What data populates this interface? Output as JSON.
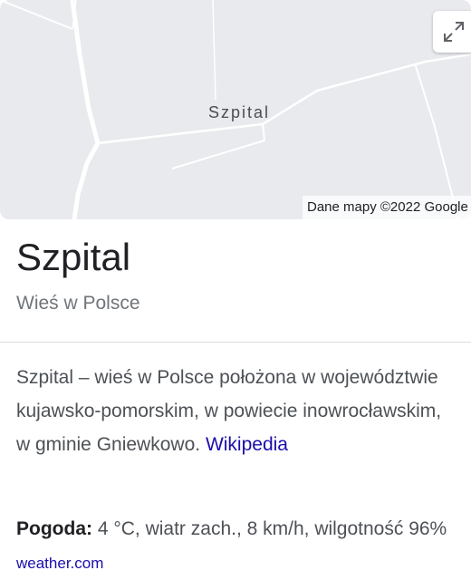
{
  "map": {
    "place_label": "Szpital",
    "attribution": "Dane mapy ©2022 Google",
    "expand_icon": "expand-icon"
  },
  "place": {
    "title": "Szpital",
    "subtitle": "Wieś w Polsce"
  },
  "description": {
    "text": "Szpital – wieś w Polsce położona w województwie kujawsko-pomorskim, w powiecie inowrocławskim, w gminie Gniewkowo.",
    "source_link": "Wikipedia"
  },
  "weather": {
    "label": "Pogoda:",
    "value": "4 °C, wiatr zach., 8 km/h, wilgotność 96%",
    "source_link": "weather.com"
  },
  "colors": {
    "link": "#1a0dab",
    "map_bg": "#e8eaed"
  }
}
